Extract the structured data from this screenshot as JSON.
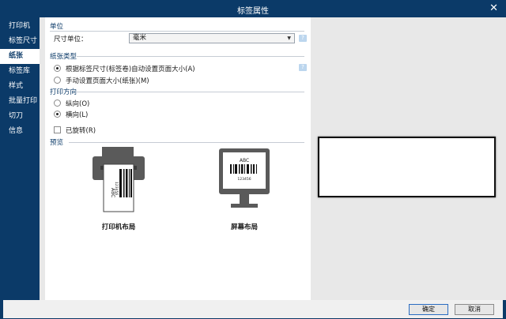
{
  "window": {
    "title": "标签属性",
    "close_glyph": "✕"
  },
  "sidebar": {
    "items": [
      {
        "label": "打印机",
        "active": false
      },
      {
        "label": "标签尺寸",
        "active": false
      },
      {
        "label": "纸张",
        "active": true
      },
      {
        "label": "标签库",
        "active": false
      },
      {
        "label": "样式",
        "active": false
      },
      {
        "label": "批量打印",
        "active": false
      },
      {
        "label": "切刀",
        "active": false
      },
      {
        "label": "信息",
        "active": false
      }
    ]
  },
  "units": {
    "header": "单位",
    "label": "尺寸单位：",
    "selected": "毫米"
  },
  "paper_type": {
    "header": "纸张类型",
    "option_auto": "根据标签尺寸(标签卷)自动设置页面大小(A)",
    "option_manual": "手动设置页面大小(纸张)(M)",
    "selected": "auto"
  },
  "orientation": {
    "header": "打印方向",
    "option_portrait": "纵向(O)",
    "option_landscape": "横向(L)",
    "selected": "landscape",
    "rotated_label": "已旋转(R)",
    "rotated_checked": false
  },
  "preview": {
    "header": "预览",
    "printer_layout_label": "打印机布局",
    "screen_layout_label": "屏幕布局",
    "barcode_letters": "ABC",
    "barcode_number": "123456"
  },
  "footer": {
    "ok_label": "确定",
    "cancel_label": "取消"
  },
  "icons": {
    "help": "help-icon",
    "dropdown": "chevron-down-icon"
  },
  "colors": {
    "chrome": "#0b3a68",
    "accent_header": "#0b3a68",
    "panel_bg": "#e8e8e8"
  }
}
